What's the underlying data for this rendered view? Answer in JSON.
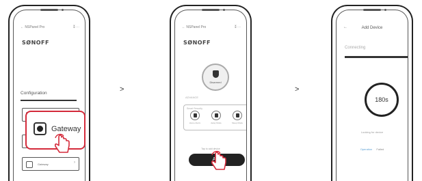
{
  "screen1": {
    "back_title": "← NSPanel Pro",
    "top_icons": "⁑ ⋯",
    "brand": "SØNOFF",
    "configuration_label": "Configuration",
    "menu_items": [
      {
        "label": "Device",
        "icon": "device-icon"
      },
      {
        "label": "",
        "icon": "gateway-hub-icon"
      },
      {
        "label": "Gateway",
        "icon": "gateway-icon"
      }
    ],
    "callout_label": "Gateway"
  },
  "screen2": {
    "back_title": "← NSPanel Pro",
    "top_icons": "⁑ ⋯",
    "brand": "SØNOFF",
    "status_label": "Disarmed",
    "section_label": "ADVANCE",
    "modes_title": "Smart Security",
    "modes": [
      {
        "label": "Home Alarm",
        "icon": "home-alarm-icon"
      },
      {
        "label": "Away Mode",
        "icon": "away-mode-icon"
      },
      {
        "label": "Sleep Mode",
        "icon": "sleep-mode-icon"
      }
    ],
    "hint": "Tap to add device",
    "add_label": "Add"
  },
  "screen3": {
    "back_arrow": "←",
    "title": "Add Device",
    "connecting_label": "Connecting",
    "timer": "180s",
    "looking_label": "Looking for device",
    "link_primary": "Operation",
    "link_secondary": "Failed"
  },
  "arrows": [
    ">",
    ">"
  ],
  "colors": {
    "accent": "#d42a3a",
    "button": "#222222",
    "link": "#5a9fd4"
  }
}
